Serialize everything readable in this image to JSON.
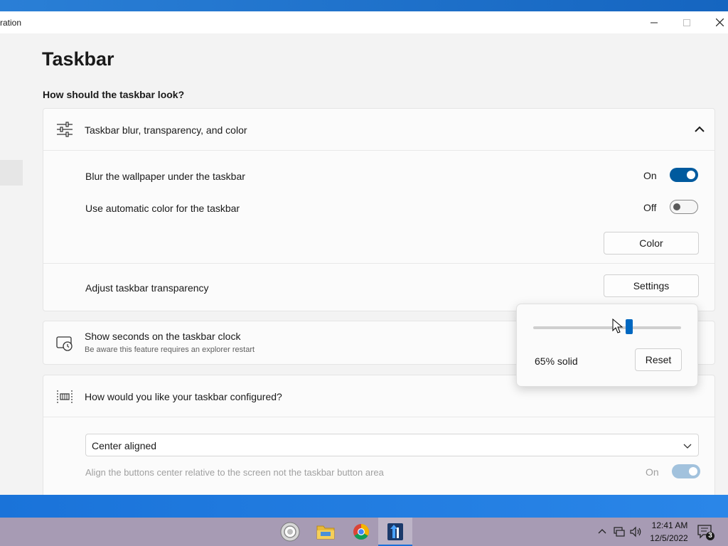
{
  "window": {
    "title": "ration"
  },
  "page": {
    "title": "Taskbar",
    "section_header": "How should the taskbar look?"
  },
  "blur_card": {
    "title": "Taskbar blur, transparency, and color",
    "icon": "sliders-icon",
    "expanded": true,
    "rows": {
      "blur": {
        "label": "Blur the wallpaper under the taskbar",
        "state_label": "On",
        "on": true
      },
      "auto_color": {
        "label": "Use automatic color for the taskbar",
        "state_label": "Off",
        "on": false
      },
      "color_button": "Color",
      "transparency": {
        "label": "Adjust taskbar transparency",
        "button": "Settings"
      }
    }
  },
  "seconds_card": {
    "title": "Show seconds on the taskbar clock",
    "subtitle": "Be aware this feature requires an explorer restart",
    "icon": "clock-icon"
  },
  "config_card": {
    "title": "How would you like your taskbar configured?",
    "icon": "taskbar-align-icon",
    "dropdown_value": "Center aligned",
    "align_text": "Align the buttons center relative to the screen not the taskbar button area",
    "align_state_label": "On",
    "align_on": true,
    "align_disabled": true
  },
  "transparency_flyout": {
    "slider_fraction": 0.65,
    "value_label": "65% solid",
    "reset_label": "Reset"
  },
  "taskbar": {
    "apps": [
      "start-orb-icon",
      "file-explorer-icon",
      "chrome-icon",
      "app-icon"
    ],
    "tray_icons": [
      "chevron-up-icon",
      "network-icon",
      "volume-icon"
    ],
    "time": "12:41 AM",
    "date": "12/5/2022",
    "notification_count": "3"
  },
  "colors": {
    "accent": "#005a9e",
    "slider_thumb": "#0067c0",
    "taskbar_bg": "#a79bb4",
    "desktop": "#1d6fc7"
  }
}
